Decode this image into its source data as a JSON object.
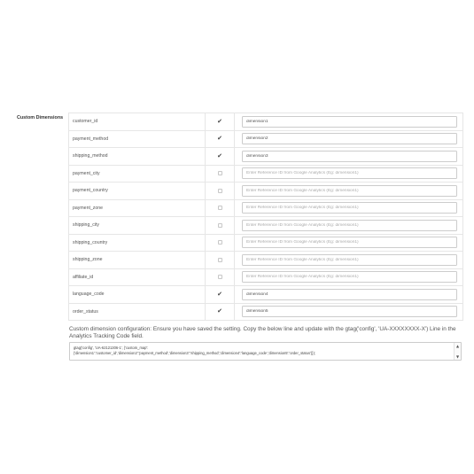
{
  "section_label": "Custom Dimensions",
  "placeholder": "Enter Reference ID from Google Analytics (Eg: dimension1)",
  "rows": [
    {
      "name": "customer_id",
      "checked": true,
      "value": "dimension1"
    },
    {
      "name": "payment_method",
      "checked": true,
      "value": "dimension2"
    },
    {
      "name": "shipping_method",
      "checked": true,
      "value": "dimension3"
    },
    {
      "name": "payment_city",
      "checked": false,
      "value": ""
    },
    {
      "name": "payment_country",
      "checked": false,
      "value": ""
    },
    {
      "name": "payment_zone",
      "checked": false,
      "value": ""
    },
    {
      "name": "shipping_city",
      "checked": false,
      "value": ""
    },
    {
      "name": "shipping_country",
      "checked": false,
      "value": ""
    },
    {
      "name": "shipping_zone",
      "checked": false,
      "value": ""
    },
    {
      "name": "affiliate_id",
      "checked": false,
      "value": ""
    },
    {
      "name": "language_code",
      "checked": true,
      "value": "dimension4"
    },
    {
      "name": "order_status",
      "checked": true,
      "value": "dimension5"
    }
  ],
  "config_note": "Custom dimension configuration: Ensure you have saved the setting. Copy the below line and update with the gtag('config', 'UA-XXXXXXXX-X') Line in the Analytics Tracking Code field.",
  "code_lines": [
    "gtag('config', 'UA-62121306-1', {'custom_map':",
    "{'dimension1':'customer_id','dimension2':'payment_method','dimension3':'shipping_method','dimension4':'language_code','dimension5':'order_status'}});"
  ],
  "icons": {
    "check": "checkmark-icon",
    "scroll_up": "scroll-up-arrow-icon",
    "scroll_down": "scroll-down-arrow-icon"
  }
}
